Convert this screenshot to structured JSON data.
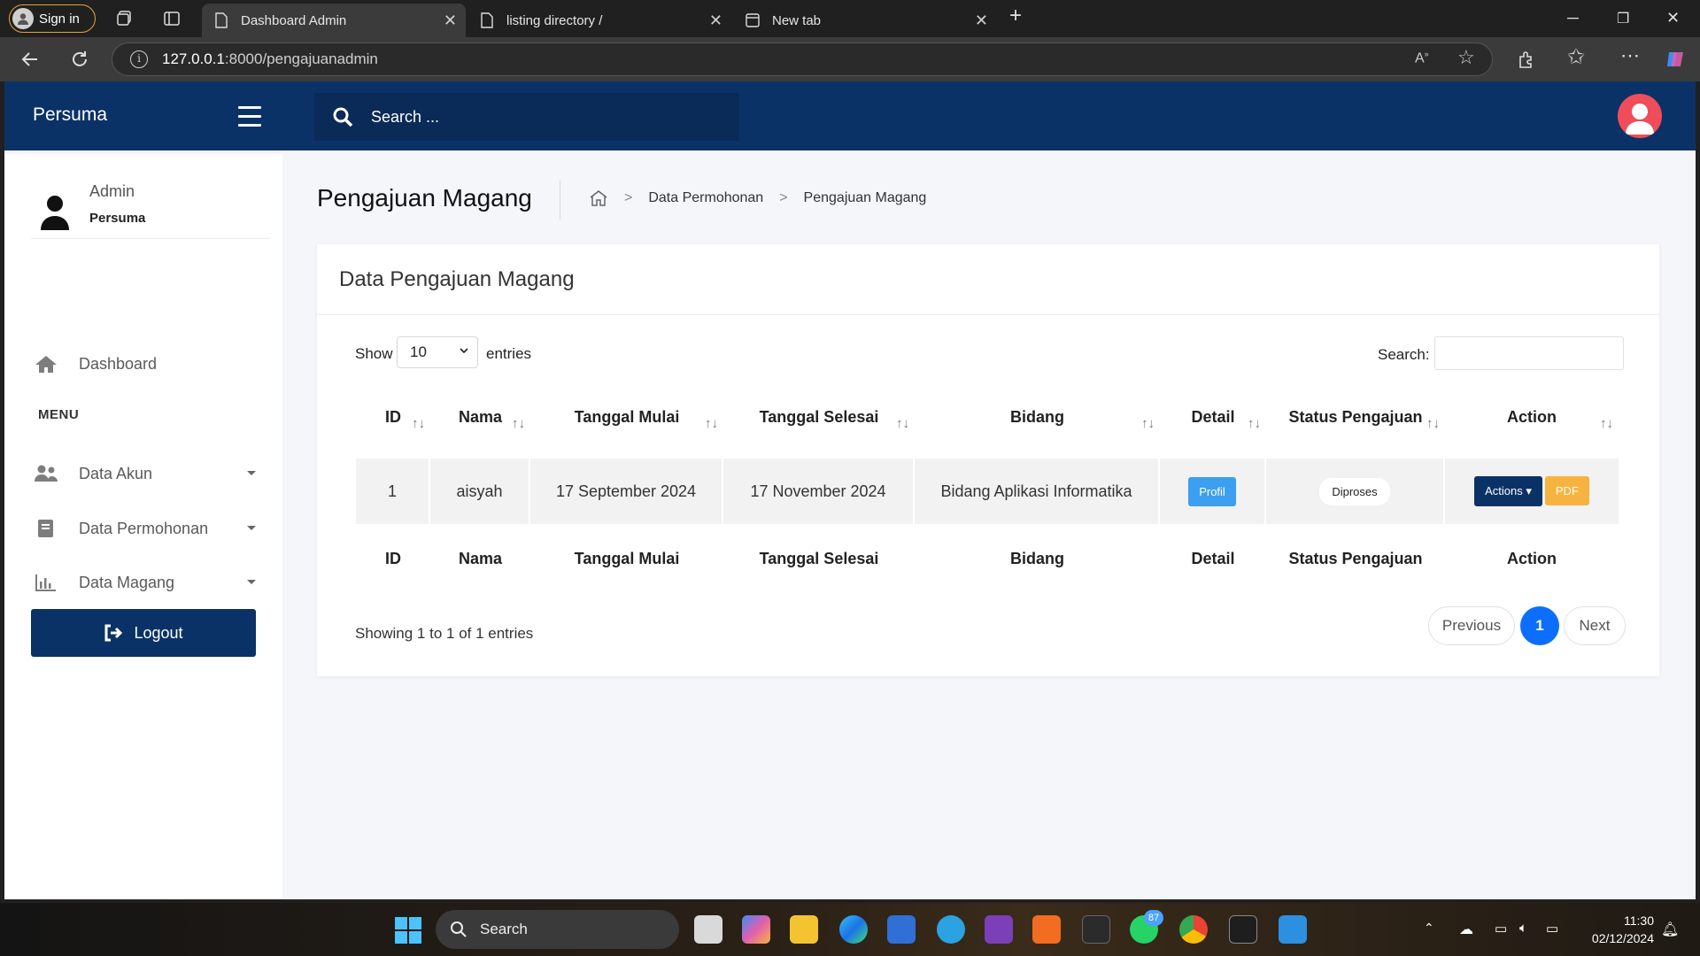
{
  "browser": {
    "signin_label": "Sign in",
    "tabs": [
      {
        "label": "Dashboard Admin",
        "active": true
      },
      {
        "label": "listing directory /",
        "active": false
      },
      {
        "label": "New tab",
        "active": false
      }
    ],
    "url_host": "127.0.0.1",
    "url_rest": ":8000/pengajuanadmin"
  },
  "topnav": {
    "brand": "Persuma",
    "search_placeholder": "Search ..."
  },
  "sidebar": {
    "user_name": "Admin",
    "user_org": "Persuma",
    "dashboard_label": "Dashboard",
    "menu_title": "MENU",
    "items": [
      {
        "label": "Data Akun",
        "icon": "users-icon"
      },
      {
        "label": "Data Permohonan",
        "icon": "book-icon"
      },
      {
        "label": "Data Magang",
        "icon": "bar-chart-icon"
      }
    ],
    "logout_label": "Logout"
  },
  "main": {
    "title": "Pengajuan Magang",
    "breadcrumb": [
      "Data Permohonan",
      "Pengajuan Magang"
    ]
  },
  "card": {
    "title": "Data Pengajuan Magang",
    "show_label": "Show",
    "show_value": "10",
    "entries_label": "entries",
    "search_label": "Search:",
    "columns": [
      "ID",
      "Nama",
      "Tanggal Mulai",
      "Tanggal Selesai",
      "Bidang",
      "Detail",
      "Status Pengajuan",
      "Action"
    ],
    "rows": [
      {
        "id": "1",
        "nama": "aisyah",
        "mulai": "17 September 2024",
        "selesai": "17 November 2024",
        "bidang": "Bidang Aplikasi Informatika",
        "detail_btn": "Profil",
        "status": "Diproses",
        "actions_btn": "Actions",
        "pdf_btn": "PDF"
      }
    ],
    "info": "Showing 1 to 1 of 1 entries",
    "pagination": {
      "prev": "Previous",
      "current": "1",
      "next": "Next"
    }
  },
  "taskbar": {
    "search_label": "Search",
    "badge": "87",
    "time": "11:30",
    "date": "02/12/2024"
  },
  "colors": {
    "navy": "#0b3266",
    "profil_blue": "#3d9ff0",
    "pdf_orange": "#f7b340",
    "page_active": "#0d6efd",
    "avatar_red": "#ef4d59"
  }
}
